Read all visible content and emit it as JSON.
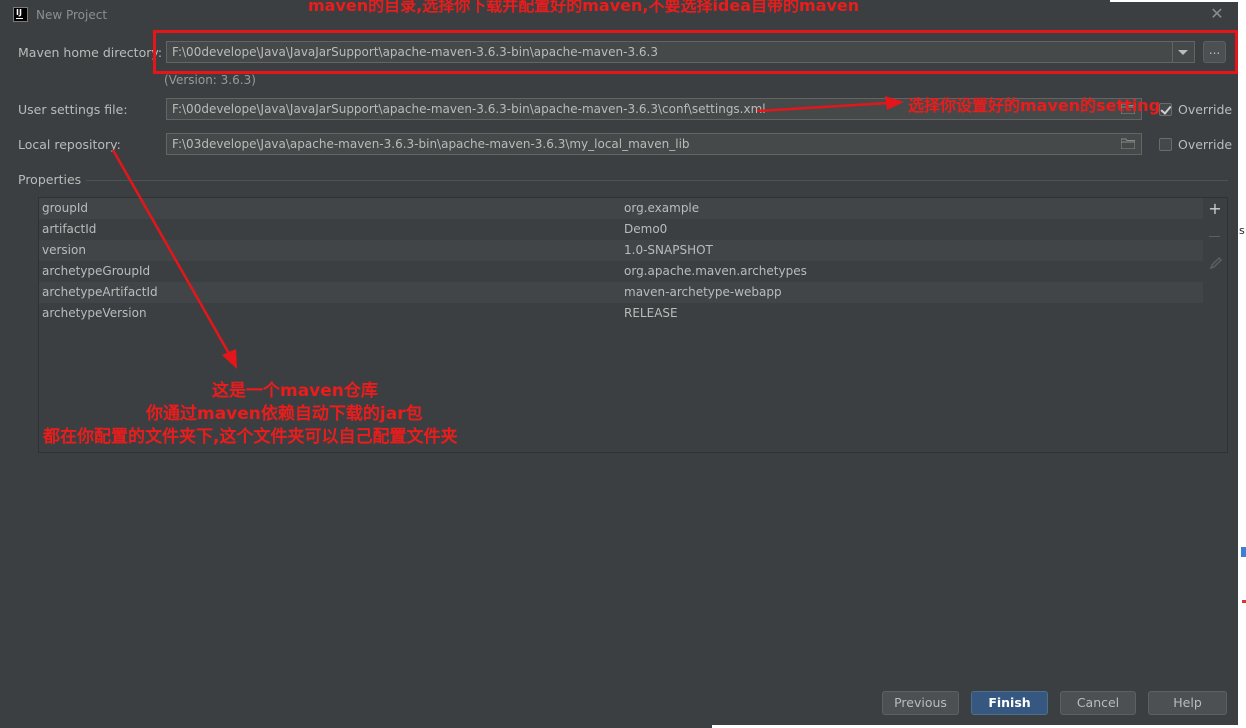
{
  "window": {
    "title": "New Project",
    "app_icon_text": "IJ"
  },
  "form": {
    "maven_home": {
      "label": "Maven home directory:",
      "value": "F:\\00develope\\Java\\JavaJarSupport\\apache-maven-3.6.3-bin\\apache-maven-3.6.3",
      "browse_label": "...",
      "version_text": "(Version: 3.6.3)"
    },
    "user_settings": {
      "label": "User settings file:",
      "value": "F:\\00develope\\Java\\JavaJarSupport\\apache-maven-3.6.3-bin\\apache-maven-3.6.3\\conf\\settings.xml",
      "override_label": "Override",
      "override_checked": true
    },
    "local_repo": {
      "label": "Local repository:",
      "value": "F:\\03develope\\Java\\apache-maven-3.6.3-bin\\apache-maven-3.6.3\\my_local_maven_lib",
      "override_label": "Override",
      "override_checked": false
    }
  },
  "properties": {
    "title": "Properties",
    "rows": [
      {
        "key": "groupId",
        "value": "org.example"
      },
      {
        "key": "artifactId",
        "value": "Demo0"
      },
      {
        "key": "version",
        "value": "1.0-SNAPSHOT"
      },
      {
        "key": "archetypeGroupId",
        "value": "org.apache.maven.archetypes"
      },
      {
        "key": "archetypeArtifactId",
        "value": "maven-archetype-webapp"
      },
      {
        "key": "archetypeVersion",
        "value": "RELEASE"
      }
    ],
    "toolbar": {
      "add": "+"
    }
  },
  "buttons": {
    "previous": "Previous",
    "finish": "Finish",
    "cancel": "Cancel",
    "help": "Help"
  },
  "annotations": {
    "top": "maven的目录,选择你下载并配置好的maven,不要选择idea自带的maven",
    "settings": "选择你设置好的maven的setting",
    "repo_line1": "这是一个maven仓库",
    "repo_line2": "你通过maven依赖自动下载的jar包",
    "repo_line3": "都在你配置的文件夹下,这个文件夹可以自己配置文件夹"
  },
  "colors": {
    "background": "#3c3f41",
    "annotation_red": "#e5161a",
    "primary_button": "#365880"
  }
}
